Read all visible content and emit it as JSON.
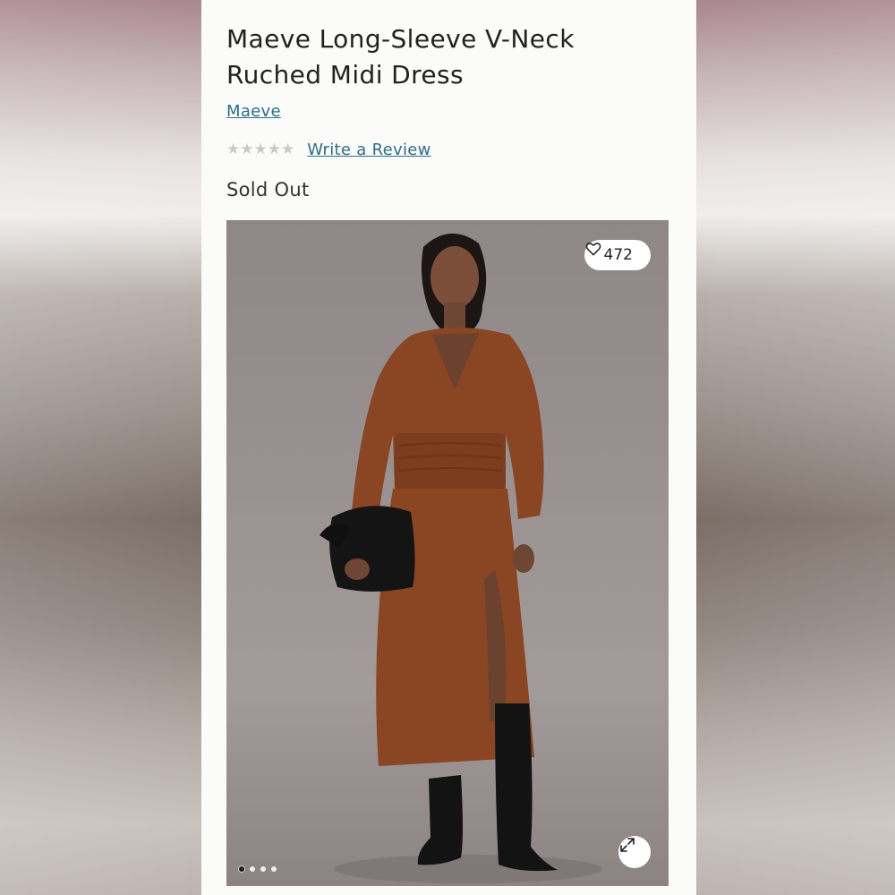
{
  "product": {
    "title": "Maeve Long-Sleeve V-Neck Ruched Midi Dress",
    "brand": "Maeve",
    "rating": {
      "value": 0,
      "max": 5
    },
    "review_link": "Write a Review",
    "availability": "Sold Out"
  },
  "gallery": {
    "likes": "472",
    "total_images": 4,
    "active_index": 0,
    "icons": {
      "like": "heart-icon",
      "expand": "expand-icon"
    }
  },
  "colors": {
    "link": "#2c6f86",
    "star_empty": "#c9c9c9",
    "dress": "#8a4523",
    "panel": "#fbfbf9"
  }
}
